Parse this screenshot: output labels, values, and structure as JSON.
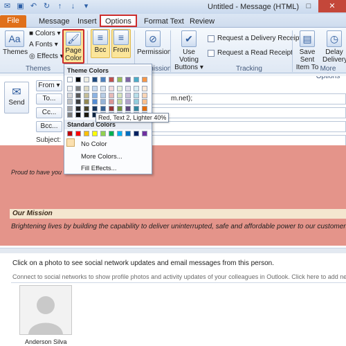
{
  "window": {
    "title": "Untitled - Message (HTML)",
    "buttons": [
      "–",
      "□",
      "✕"
    ]
  },
  "tabs": [
    "File",
    "Message",
    "Insert",
    "Options",
    "Format Text",
    "Review"
  ],
  "ribbon": {
    "themes": {
      "big": "Themes",
      "colors": "Colors",
      "fonts": "Fonts",
      "effects": "Effects",
      "group": "Themes"
    },
    "page_color": "Page Color",
    "bcc": "Bcc",
    "from": "From",
    "permission": "Permission",
    "permission_group": "Permission",
    "voting": "Use Voting Buttons",
    "delivery_receipt": "Request a Delivery Receipt",
    "read_receipt": "Request a Read Receipt",
    "tracking_group": "Tracking",
    "save_sent": "Save Sent Item To",
    "delay": "Delay Delivery",
    "more_options_group": "More Options"
  },
  "header": {
    "send": "Send",
    "from": "From",
    "to": "To...",
    "cc": "Cc...",
    "bcc": "Bcc...",
    "subject": "Subject:",
    "to_value": "m.net);"
  },
  "dropdown": {
    "theme_colors": "Theme Colors",
    "standard_colors": "Standard Colors",
    "no_color": "No Color",
    "more_colors": "More Colors...",
    "fill_effects": "Fill Effects...",
    "tooltip": "Red, Text 2, Lighter 40%",
    "theme_top": [
      "#ffffff",
      "#000000",
      "#eeece1",
      "#1f497d",
      "#4f81bd",
      "#c0504d",
      "#9bbb59",
      "#8064a2",
      "#4bacc6",
      "#f79646"
    ],
    "theme_shades": [
      [
        "#f2f2f2",
        "#7f7f7f",
        "#ddd9c3",
        "#c6d9f0",
        "#dbe5f1",
        "#f2dcdb",
        "#ebf1dd",
        "#e5e0ec",
        "#dbeef3",
        "#fdeada"
      ],
      [
        "#d8d8d8",
        "#595959",
        "#c4bd97",
        "#8db3e2",
        "#b8cce4",
        "#e5b9b7",
        "#d7e3bc",
        "#ccc1d9",
        "#b7dde8",
        "#fbd5b5"
      ],
      [
        "#bfbfbf",
        "#3f3f3f",
        "#938953",
        "#548dd4",
        "#95b3d7",
        "#d99694",
        "#c3d69b",
        "#b2a2c7",
        "#92cddc",
        "#fac08f"
      ],
      [
        "#a5a5a5",
        "#262626",
        "#494429",
        "#17365d",
        "#366092",
        "#953734",
        "#76923c",
        "#5f497a",
        "#31859b",
        "#e36c09"
      ],
      [
        "#7f7f7f",
        "#0c0c0c",
        "#1d1b10",
        "#0f243e",
        "#244061",
        "#632423",
        "#4f6128",
        "#3f3151",
        "#205867",
        "#974806"
      ]
    ],
    "standard": [
      "#c00000",
      "#ff0000",
      "#ffc000",
      "#ffff00",
      "#92d050",
      "#00b050",
      "#00b0f0",
      "#0070c0",
      "#002060",
      "#7030a0"
    ]
  },
  "body": {
    "proud": "Proud to have you",
    "mission_title": "Our Mission",
    "mission_text": "Brightening lives by building the capability to deliver uninterrupted, safe and affordable power to our customers."
  },
  "social": {
    "line1": "Click on a photo to see social network updates and email messages from this person.",
    "line2": "Connect to social networks to show profile photos and activity updates of your colleagues in Outlook. Click here to add net",
    "contact": "Anderson Silva"
  },
  "colors": {
    "body_bg": "#e4948a",
    "file_tab": "#e0701a",
    "highlight": "#cc2b2b"
  }
}
